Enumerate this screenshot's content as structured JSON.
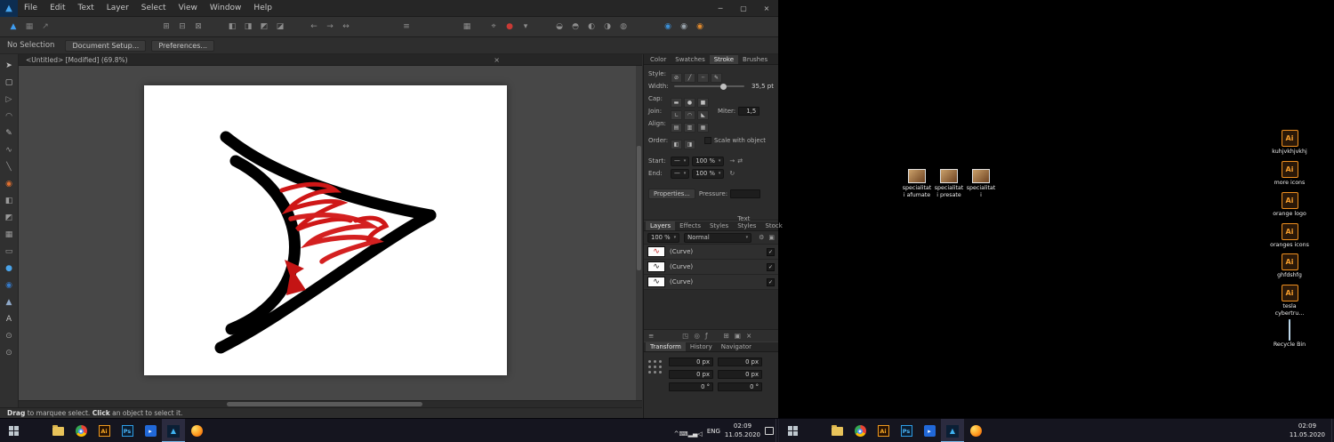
{
  "titlebar": {
    "logo_glyph": "▲",
    "menus": [
      {
        "label": "File"
      },
      {
        "label": "Edit"
      },
      {
        "label": "Text"
      },
      {
        "label": "Layer"
      },
      {
        "label": "Select"
      },
      {
        "label": "View"
      },
      {
        "label": "Window"
      },
      {
        "label": "Help"
      }
    ],
    "minimize": "─",
    "maximize": "▢",
    "close": "×"
  },
  "toolbar": {
    "icons": [
      {
        "name": "designer-persona-icon",
        "glyph": "▲",
        "color": "#3f9df0"
      },
      {
        "name": "pixel-persona-icon",
        "glyph": "▦",
        "color": "#7b7b7b"
      },
      {
        "name": "export-persona-icon",
        "glyph": "↗",
        "color": "#7b7b7b"
      },
      {
        "name": "insert-top-icon",
        "glyph": "⊞",
        "cls": "gA"
      },
      {
        "name": "insert-inside-icon",
        "glyph": "⊟"
      },
      {
        "name": "insert-behind-icon",
        "glyph": "⊠"
      },
      {
        "name": "align-left-icon",
        "glyph": "◧",
        "cls": "gB"
      },
      {
        "name": "align-center-icon",
        "glyph": "◨"
      },
      {
        "name": "align-top-icon",
        "glyph": "◩"
      },
      {
        "name": "align-bottom-icon",
        "glyph": "◪"
      },
      {
        "name": "order-back-icon",
        "glyph": "←",
        "cls": "gB"
      },
      {
        "name": "order-forward-icon",
        "glyph": "→"
      },
      {
        "name": "order-swap-icon",
        "glyph": "↔"
      },
      {
        "name": "tool-options-icon",
        "glyph": "≡",
        "cls": "gC"
      },
      {
        "name": "grid-toggle-icon",
        "glyph": "▦",
        "cls": "gC"
      },
      {
        "name": "snapping-icon",
        "glyph": "⌖",
        "cls": "gS"
      },
      {
        "name": "snapping-active-icon",
        "glyph": "●",
        "color": "#c93a35"
      },
      {
        "name": "snapping-menu-icon",
        "glyph": "▾"
      },
      {
        "name": "boolean-union-icon",
        "glyph": "◒",
        "cls": "gB"
      },
      {
        "name": "boolean-subtract-icon",
        "glyph": "◓"
      },
      {
        "name": "boolean-intersect-icon",
        "glyph": "◐"
      },
      {
        "name": "boolean-xor-icon",
        "glyph": "◑"
      },
      {
        "name": "boolean-divide-icon",
        "glyph": "◍"
      },
      {
        "name": "fill-swatch-icon",
        "glyph": "◉",
        "color": "#3b8fd6",
        "cls": "gD"
      },
      {
        "name": "stroke-swatch-icon",
        "glyph": "◉",
        "color": "#98a2aa"
      },
      {
        "name": "accent-swatch-icon",
        "glyph": "◉",
        "color": "#e08a2e"
      }
    ]
  },
  "context_bar": {
    "status": "No Selection",
    "document_setup": "Document Setup...",
    "preferences": "Preferences..."
  },
  "doc_tab": {
    "title": "<Untitled> [Modified] (69.8%)",
    "close": "×"
  },
  "tools": {
    "icons": [
      {
        "name": "move-tool-icon",
        "glyph": "➤",
        "color": "#c0c0c0"
      },
      {
        "name": "artboard-tool-icon",
        "glyph": "▢",
        "color": "#c0c0c0"
      },
      {
        "name": "node-tool-icon",
        "glyph": "▷",
        "color": "#9a9a9a"
      },
      {
        "name": "corner-tool-icon",
        "glyph": "◠",
        "color": "#9a9a9a"
      },
      {
        "name": "pen-tool-icon",
        "glyph": "✎",
        "color": "#b5b5b5"
      },
      {
        "name": "pencil-tool-icon",
        "glyph": "∿",
        "color": "#9a9a9a"
      },
      {
        "name": "brush-tool-icon",
        "glyph": "╲",
        "color": "#9a9a9a"
      },
      {
        "name": "fill-tool-icon",
        "glyph": "◉",
        "color": "#e07030"
      },
      {
        "name": "gradient-tool-icon",
        "glyph": "◧",
        "color": "#9a9a9a"
      },
      {
        "name": "transparency-tool-icon",
        "glyph": "◩",
        "color": "#9a9a9a"
      },
      {
        "name": "crop-tool-icon",
        "glyph": "▦",
        "color": "#9a9a9a"
      },
      {
        "name": "shape-tool-icon",
        "glyph": "▭",
        "color": "#9a9a9a"
      },
      {
        "name": "ellipse-tool-icon",
        "glyph": "●",
        "color": "#4aa3e8"
      },
      {
        "name": "color-sphere-tool-icon",
        "glyph": "◉",
        "color": "#3579c8"
      },
      {
        "name": "triangle-tool-icon",
        "glyph": "▲",
        "color": "#8fa8c8"
      },
      {
        "name": "text-tool-icon",
        "glyph": "A",
        "color": "#c0c0c0"
      },
      {
        "name": "eyedropper-tool-icon",
        "glyph": "⊙",
        "color": "#9a9a9a"
      },
      {
        "name": "zoom-tool-icon",
        "glyph": "⊙",
        "color": "#9a9a9a"
      }
    ]
  },
  "stroke_panel": {
    "tabs": [
      {
        "label": "Color"
      },
      {
        "label": "Swatches"
      },
      {
        "label": "Stroke",
        "active": true
      },
      {
        "label": "Brushes"
      }
    ],
    "style_label": "Style:",
    "style_options": [
      {
        "name": "stroke-none-icon",
        "glyph": "⊘"
      },
      {
        "name": "stroke-solid-icon",
        "glyph": "╱"
      },
      {
        "name": "stroke-dashed-icon",
        "glyph": "┄"
      },
      {
        "name": "stroke-brush-icon",
        "glyph": "✎"
      }
    ],
    "width_label": "Width:",
    "width_value": "35,5 pt",
    "cap_label": "Cap:",
    "cap_options": [
      {
        "name": "cap-butt-icon",
        "glyph": "▬"
      },
      {
        "name": "cap-round-icon",
        "glyph": "●"
      },
      {
        "name": "cap-square-icon",
        "glyph": "■"
      }
    ],
    "join_label": "Join:",
    "join_options": [
      {
        "name": "join-miter-icon",
        "glyph": "∟"
      },
      {
        "name": "join-round-icon",
        "glyph": "◠"
      },
      {
        "name": "join-bevel-icon",
        "glyph": "◣"
      }
    ],
    "miter_label": "Miter:",
    "miter_value": "1,5",
    "align_label": "Align:",
    "align_options": [
      {
        "name": "stroke-align-center-icon",
        "glyph": "▤"
      },
      {
        "name": "stroke-align-inside-icon",
        "glyph": "▥"
      },
      {
        "name": "stroke-align-outside-icon",
        "glyph": "▦"
      }
    ],
    "order_label": "Order:",
    "order_options": [
      {
        "name": "stroke-order-front-icon",
        "glyph": "◧"
      },
      {
        "name": "stroke-order-back-icon",
        "glyph": "◨"
      }
    ],
    "scale_with_object_label": "Scale with object",
    "start_label": "Start:",
    "start_value": "100 %",
    "end_label": "End:",
    "end_value": "100 %",
    "line_preview": "—",
    "caret": "▾",
    "start_arrow": "→",
    "swap_arrow": "⇄",
    "reset_icon": "↻",
    "properties_label": "Properties...",
    "pressure_label": "Pressure:"
  },
  "layers_panel": {
    "tabs": [
      {
        "label": "Layers",
        "active": true
      },
      {
        "label": "Effects"
      },
      {
        "label": "Styles"
      },
      {
        "label": "Text Styles"
      },
      {
        "label": "Stock"
      }
    ],
    "panel_menu_icon": "≡",
    "opacity_value": "100 %",
    "blend_mode": "Normal",
    "caret": "▾",
    "gear_icon": "⚙",
    "lock_icon": "▣",
    "rows": [
      {
        "label": "(Curve)",
        "glyph": "∿",
        "color": "#c22020",
        "check": "✓"
      },
      {
        "label": "(Curve)",
        "glyph": "∿",
        "color": "#151515",
        "check": "✓"
      },
      {
        "label": "(Curve)",
        "glyph": "∿",
        "color": "#151515",
        "check": "✓"
      }
    ],
    "footer_icons": [
      {
        "name": "layers-list-icon",
        "glyph": "≡"
      },
      {
        "name": "mask-layer-icon",
        "glyph": "◳",
        "cls": "push"
      },
      {
        "name": "adjustment-layer-icon",
        "glyph": "◎"
      },
      {
        "name": "fx-layer-icon",
        "glyph": "ƒ"
      },
      {
        "name": "new-layer-icon",
        "glyph": "⊞",
        "cls": "push2"
      },
      {
        "name": "group-layer-icon",
        "glyph": "▣"
      },
      {
        "name": "delete-layer-icon",
        "glyph": "×"
      }
    ]
  },
  "transform_panel": {
    "tabs": [
      {
        "label": "Transform",
        "active": true
      },
      {
        "label": "History"
      },
      {
        "label": "Navigator"
      }
    ],
    "fields": [
      {
        "value": "0 px"
      },
      {
        "value": "0 px"
      },
      {
        "value": "0 px"
      },
      {
        "value": "0 px"
      },
      {
        "value": "0 °"
      },
      {
        "value": "0 °"
      }
    ]
  },
  "status_bar": {
    "drag": "Drag",
    "after_drag": " to marquee select. ",
    "click": "Click",
    "after_click": " an object to select it."
  },
  "desktop": {
    "files": [
      {
        "label": "specialitati afumate"
      },
      {
        "label": "specialitati presate"
      },
      {
        "label": "specialitati"
      }
    ],
    "shortcuts": [
      {
        "label": "kuhjvkhjvkhj",
        "cls": "ds-ai",
        "badge": "Ai"
      },
      {
        "label": "more icons",
        "cls": "ds-ai",
        "badge": "Ai"
      },
      {
        "label": "orange logo",
        "cls": "ds-ai",
        "badge": "Ai"
      },
      {
        "label": "oranges icons",
        "cls": "ds-ai",
        "badge": "Ai"
      },
      {
        "label": "ghfdshfg",
        "cls": "ds-ai",
        "badge": "Ai"
      },
      {
        "label": "tesla cybertru...",
        "cls": "ds-ai",
        "badge": "Ai"
      },
      {
        "label": "Recycle Bin",
        "cls": "ds-bin",
        "badge": ""
      }
    ]
  },
  "taskbar": {
    "apps": [
      {
        "name": "file-explorer-icon",
        "cls": "i-folder"
      },
      {
        "name": "chrome-icon",
        "cls": "i-chrome"
      },
      {
        "name": "illustrator-icon",
        "cls": "i-ai",
        "glyph": "Ai"
      },
      {
        "name": "photoshop-icon",
        "cls": "i-ps",
        "glyph": "Ps"
      },
      {
        "name": "media-player-icon",
        "cls": "i-mov",
        "glyph": "▸"
      },
      {
        "name": "affinity-designer-icon",
        "cls": "i-af",
        "glyph": "▲",
        "active": true
      },
      {
        "name": "firefox-icon",
        "cls": "i-ff"
      }
    ],
    "tray": {
      "icons": [
        {
          "name": "tray-expand-icon",
          "glyph": "^"
        },
        {
          "name": "tray-keyboard-icon",
          "glyph": "⌨"
        },
        {
          "name": "tray-network-icon",
          "glyph": "▂▄"
        },
        {
          "name": "tray-volume-icon",
          "glyph": "◁"
        }
      ],
      "lang": "ENG",
      "time": "02:09",
      "date": "11.05.2020"
    },
    "clock_right": {
      "time": "02:09",
      "date": "11.05.2020"
    }
  }
}
